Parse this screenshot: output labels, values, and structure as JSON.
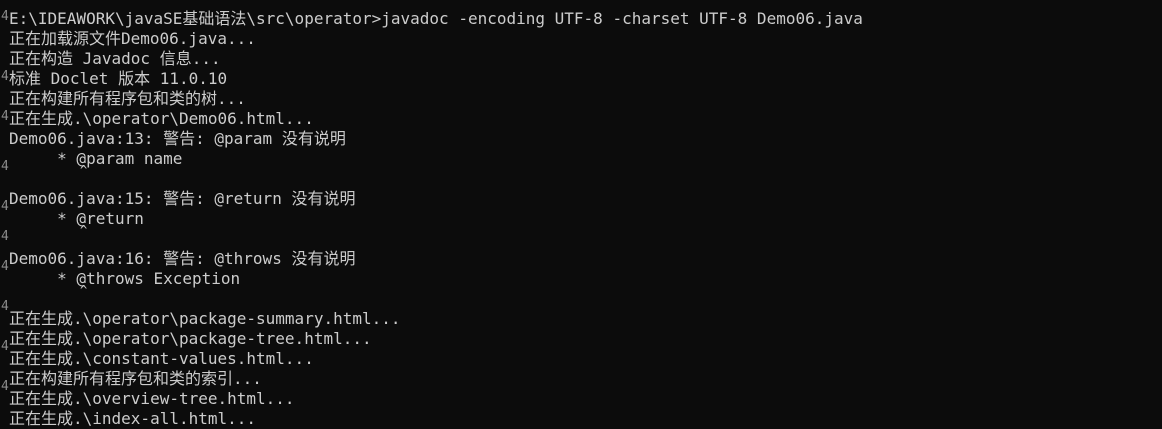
{
  "console": {
    "lines": [
      "E:\\IDEAWORK\\javaSE基础语法\\src\\operator>javadoc -encoding UTF-8 -charset UTF-8 Demo06.java",
      "正在加载源文件Demo06.java...",
      "正在构造 Javadoc 信息...",
      "标准 Doclet 版本 11.0.10",
      "正在构建所有程序包和类的树...",
      "正在生成.\\operator\\Demo06.html...",
      "Demo06.java:13: 警告: @param 没有说明",
      "     * @param name",
      "",
      "Demo06.java:15: 警告: @return 没有说明",
      "     * @return",
      "",
      "Demo06.java:16: 警告: @throws 没有说明",
      "     * @throws Exception",
      "",
      "正在生成.\\operator\\package-summary.html...",
      "正在生成.\\operator\\package-tree.html...",
      "正在生成.\\constant-values.html...",
      "正在构建所有程序包和类的索引...",
      "正在生成.\\overview-tree.html...",
      "正在生成.\\index-all.html..."
    ],
    "caret_glyph": "^",
    "gutter_glyph": "4"
  }
}
